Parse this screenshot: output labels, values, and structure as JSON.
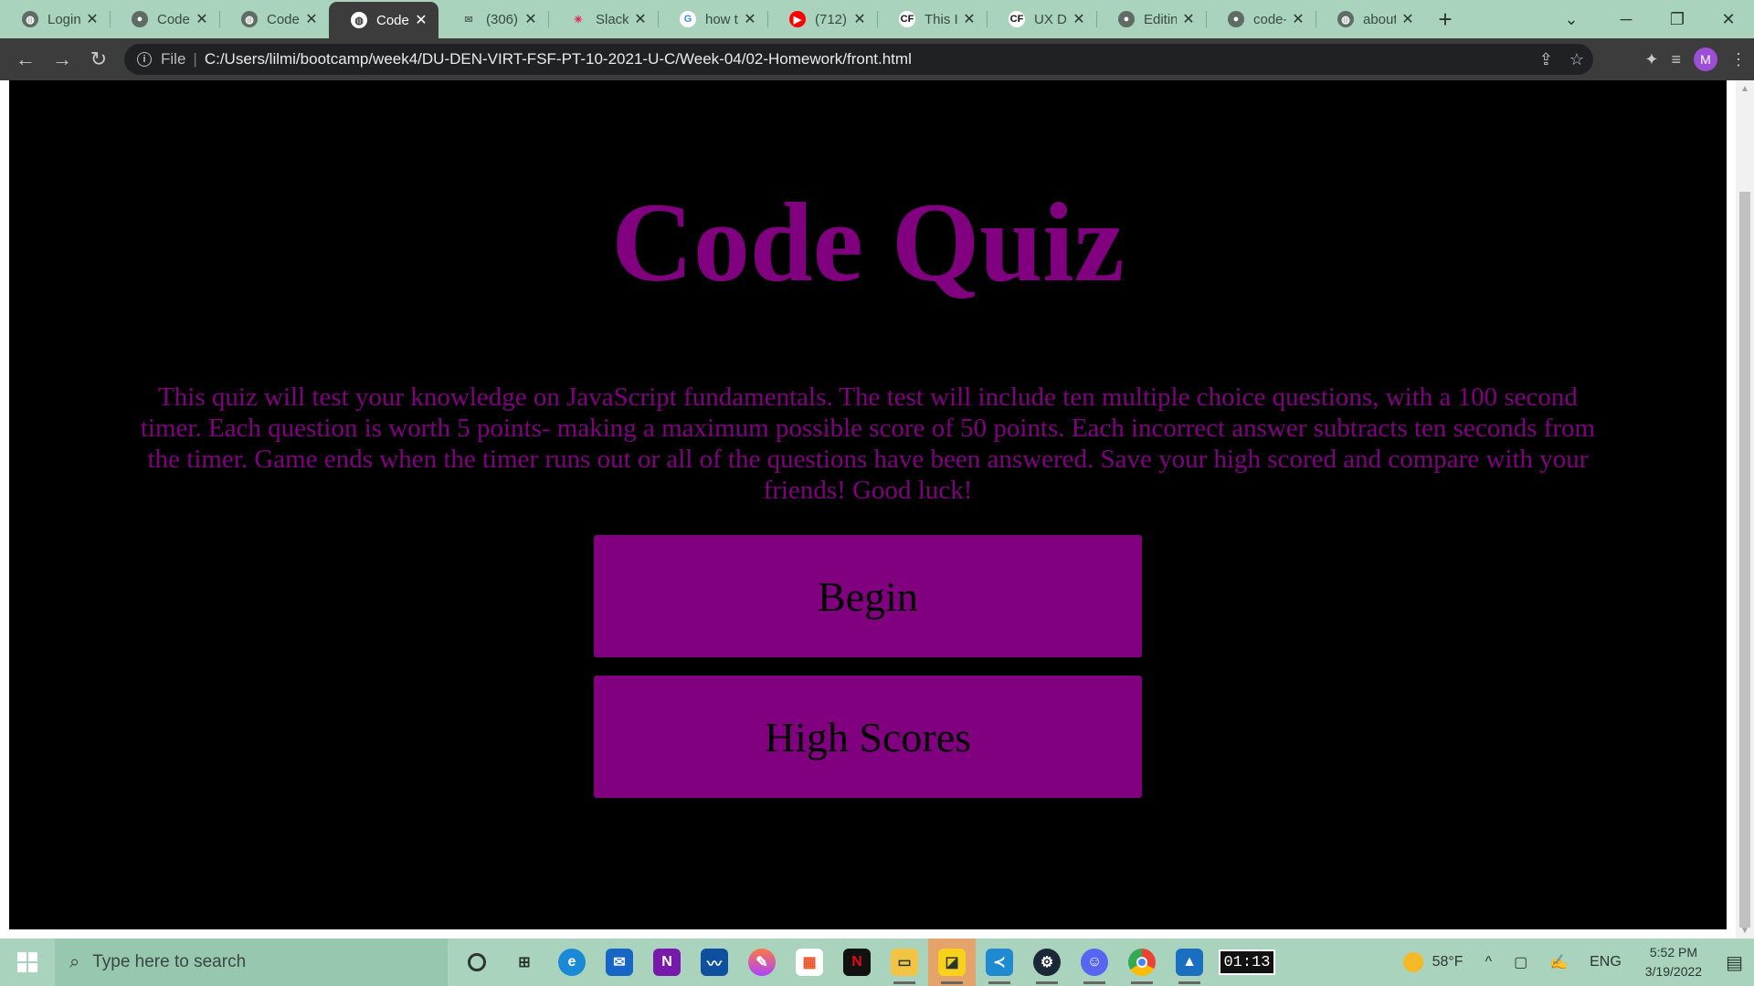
{
  "browser": {
    "tabs": [
      {
        "title": "Login",
        "favicon": "globe",
        "active": false
      },
      {
        "title": "CodeC",
        "favicon": "github",
        "active": false
      },
      {
        "title": "Code",
        "favicon": "globe",
        "active": false
      },
      {
        "title": "Code",
        "favicon": "globe",
        "active": true
      },
      {
        "title": "(306)",
        "favicon": "mail",
        "active": false
      },
      {
        "title": "Slack",
        "favicon": "slack",
        "active": false
      },
      {
        "title": "how t",
        "favicon": "google",
        "active": false
      },
      {
        "title": "(712)",
        "favicon": "youtube",
        "active": false
      },
      {
        "title": "This Is",
        "favicon": "codefights",
        "active": false
      },
      {
        "title": "UX De",
        "favicon": "codefights",
        "active": false
      },
      {
        "title": "Editin",
        "favicon": "github",
        "active": false
      },
      {
        "title": "code-",
        "favicon": "github",
        "active": false
      },
      {
        "title": "about",
        "favicon": "globe",
        "active": false
      }
    ],
    "address": {
      "scheme_label": "File",
      "url": "C:/Users/lilmi/bootcamp/week4/DU-DEN-VIRT-FSF-PT-10-2021-U-C/Week-04/02-Homework/front.html"
    },
    "profile_initial": "M"
  },
  "page": {
    "title": "Code Quiz",
    "intro": "This quiz will test your knowledge on JavaScript fundamentals. The test will include ten multiple choice questions, with a 100 second timer. Each question is worth 5 points- making a maximum possible score of 50 points. Each incorrect answer subtracts ten seconds from the timer. Game ends when the timer runs out or all of the questions have been answered. Save your high scored and compare with your friends! Good luck!",
    "begin_label": "Begin",
    "highscores_label": "High Scores",
    "colors": {
      "background": "#000000",
      "accent": "#800080"
    }
  },
  "taskbar": {
    "search_placeholder": "Type here to search",
    "timer_app": "01:13",
    "weather": "58°F",
    "language": "ENG",
    "time": "5:52 PM",
    "date": "3/19/2022"
  }
}
